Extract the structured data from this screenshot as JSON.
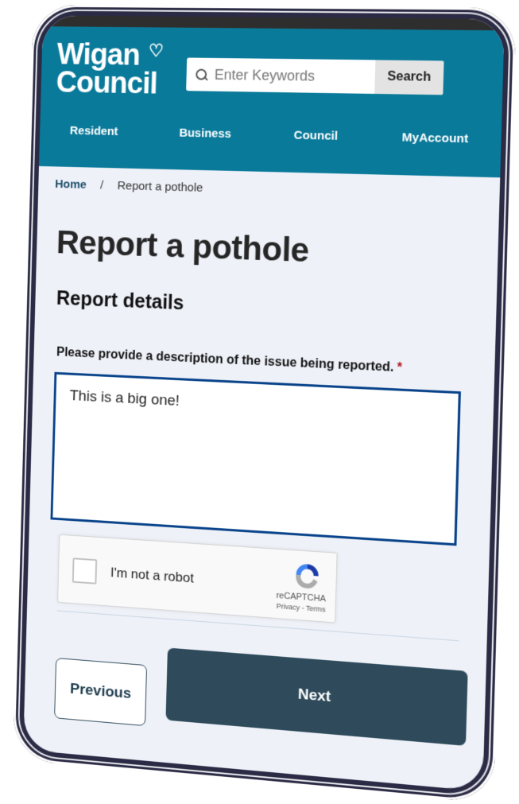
{
  "header": {
    "logo_line1": "Wigan",
    "logo_line2": "Council",
    "logo_heart": "♡",
    "search_placeholder": "Enter Keywords",
    "search_button": "Search",
    "brand_color": "#0a7a9a",
    "nav": [
      {
        "label": "Resident"
      },
      {
        "label": "Business"
      },
      {
        "label": "Council"
      },
      {
        "label": "MyAccount"
      }
    ]
  },
  "breadcrumb": {
    "home": "Home",
    "separator": "/",
    "current": "Report a pothole"
  },
  "page": {
    "title": "Report a pothole",
    "section_title": "Report details",
    "field_label": "Please provide a description of the issue being reported.",
    "required_marker": "*",
    "description_value": "This is a big one!"
  },
  "recaptcha": {
    "label": "I'm not a robot",
    "brand": "reCAPTCHA",
    "links": "Privacy - Terms"
  },
  "actions": {
    "previous": "Previous",
    "next": "Next",
    "next_color": "#2e4a5b"
  }
}
